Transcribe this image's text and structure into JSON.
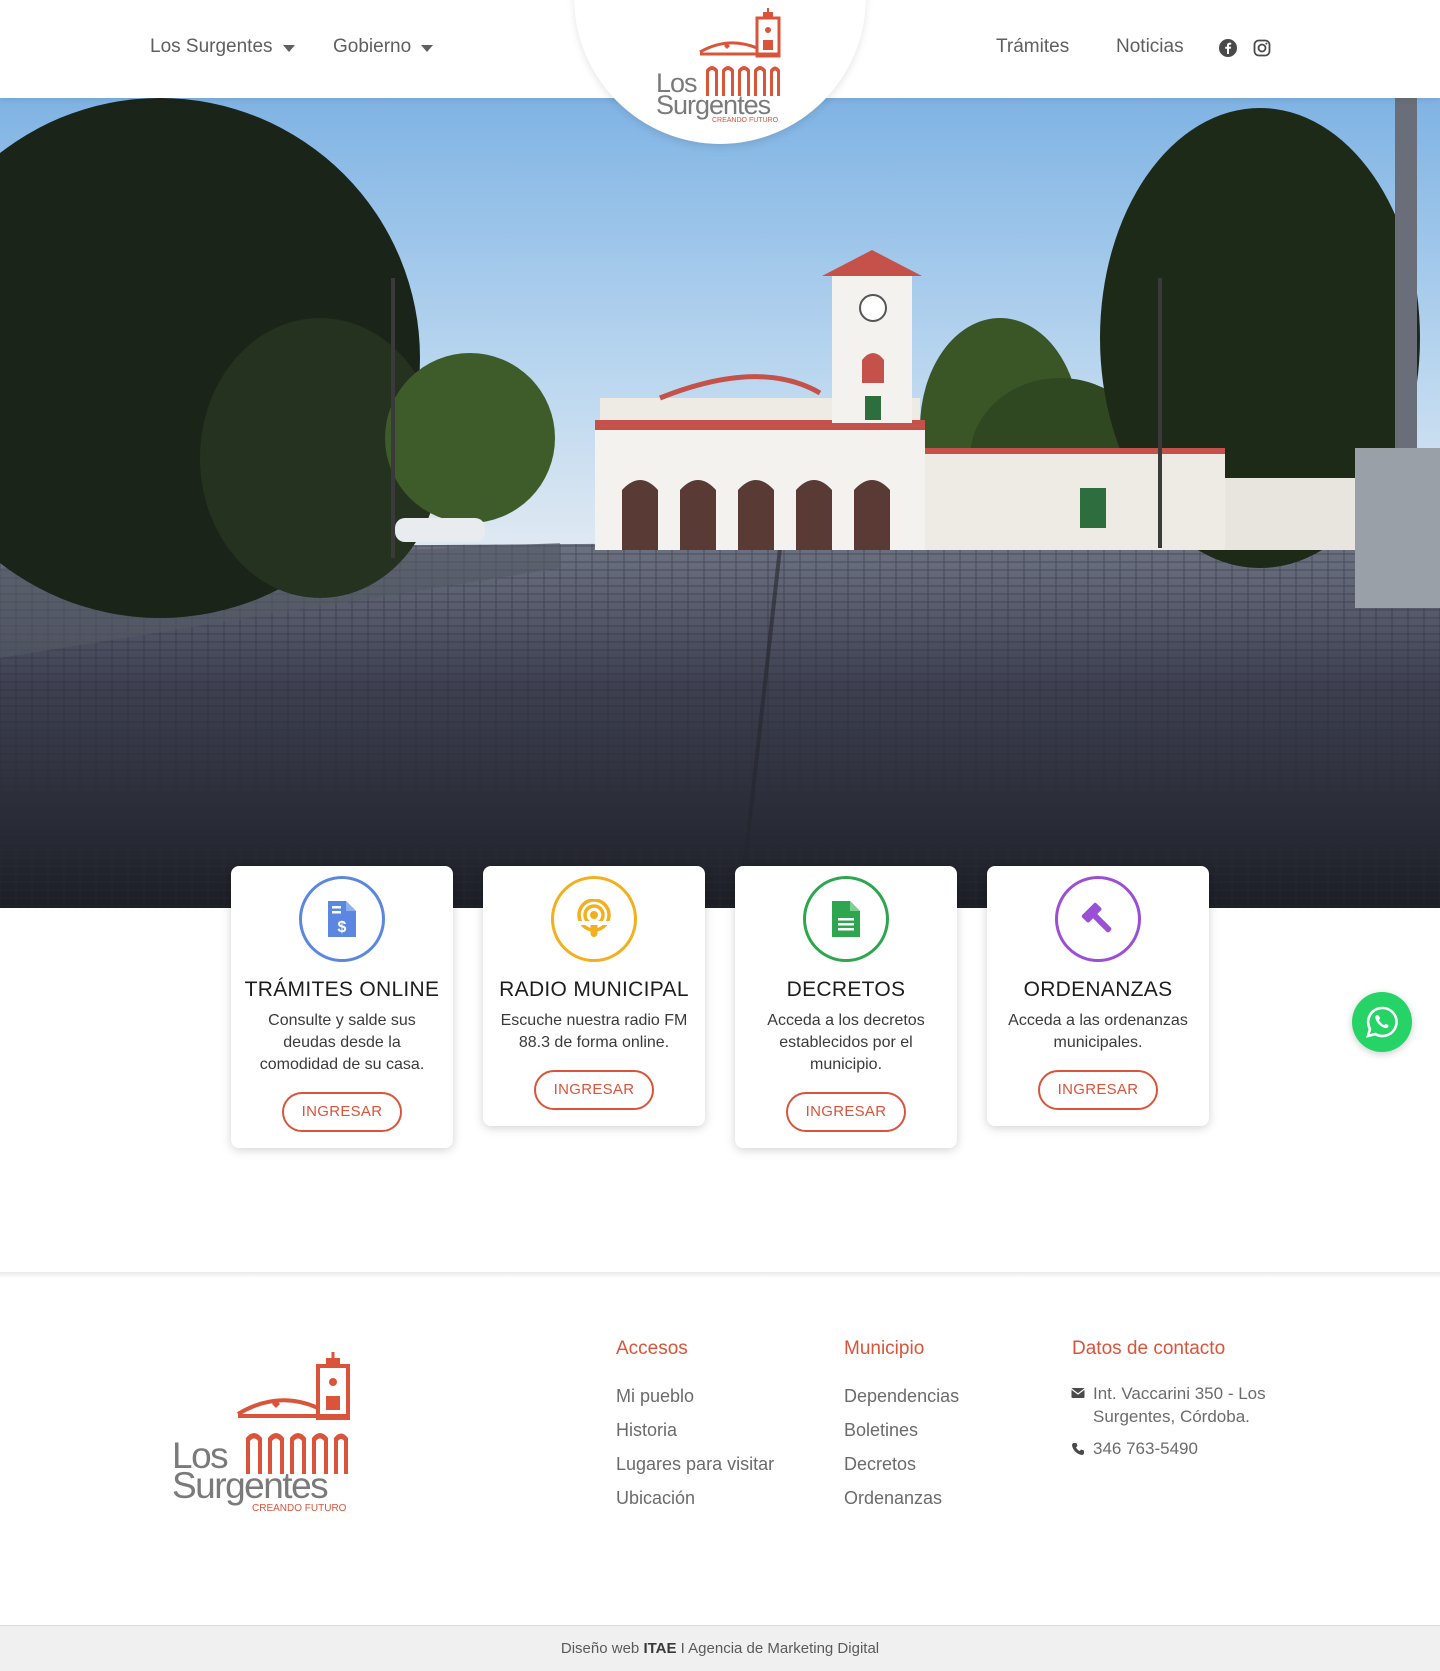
{
  "header": {
    "nav_left": [
      {
        "label": "Los Surgentes"
      },
      {
        "label": "Gobierno"
      }
    ],
    "nav_right": [
      {
        "label": "Trámites"
      },
      {
        "label": "Noticias"
      }
    ],
    "social_icons": [
      "facebook-icon",
      "instagram-icon"
    ]
  },
  "logo": {
    "line1": "Los",
    "line2": "Surgentes",
    "tagline": "CREANDO FUTURO"
  },
  "cards": [
    {
      "title": "TRÁMITES ONLINE",
      "text": "Consulte y salde sus deudas desde la comodidad de su casa.",
      "button": "INGRESAR",
      "icon": "invoice-dollar-icon",
      "color": "#5b87e0"
    },
    {
      "title": "RADIO MUNICIPAL",
      "text": "Escuche nuestra radio FM 88.3 de forma online.",
      "button": "INGRESAR",
      "icon": "podcast-icon",
      "color": "#f2b01e"
    },
    {
      "title": "DECRETOS",
      "text": "Acceda a los decretos establecidos por el municipio.",
      "button": "INGRESAR",
      "icon": "document-icon",
      "color": "#2ea64f"
    },
    {
      "title": "ORDENANZAS",
      "text": "Acceda a las ordenanzas municipales.",
      "button": "INGRESAR",
      "icon": "gavel-icon",
      "color": "#9b4fd6"
    }
  ],
  "footer": {
    "accesos": {
      "title": "Accesos",
      "links": [
        "Mi pueblo",
        "Historia",
        "Lugares para visitar",
        "Ubicación"
      ]
    },
    "municipio": {
      "title": "Municipio",
      "links": [
        "Dependencias",
        "Boletines",
        "Decretos",
        "Ordenanzas"
      ]
    },
    "contacto": {
      "title": "Datos de contacto",
      "address": "Int. Vaccarini 350 - Los Surgentes, Córdoba.",
      "phone": "346 763-5490"
    }
  },
  "bottom_bar": {
    "prefix": "Diseño web",
    "brand": "ITAE",
    "suffix": "I Agencia de Marketing Digital"
  },
  "colors": {
    "accent": "#d9543a",
    "whatsapp": "#25d366"
  }
}
